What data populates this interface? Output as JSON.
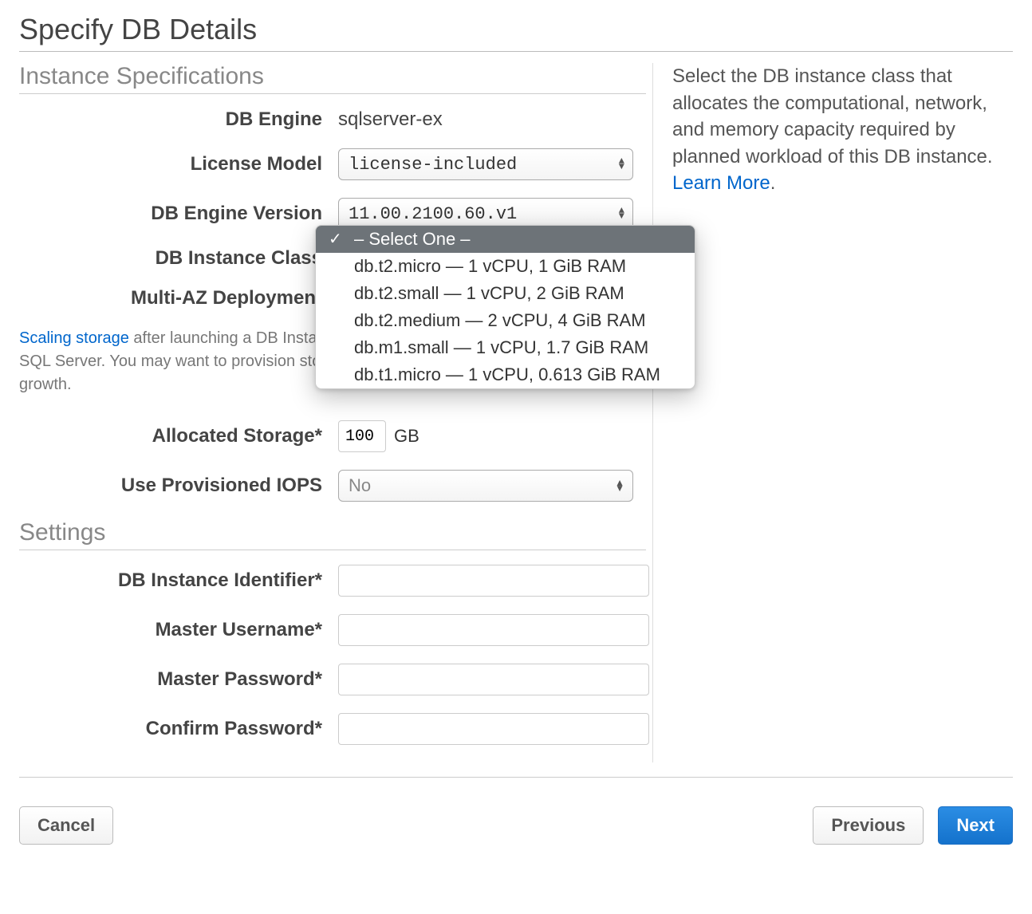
{
  "page": {
    "title": "Specify DB Details"
  },
  "sections": {
    "instance": "Instance Specifications",
    "settings": "Settings"
  },
  "labels": {
    "db_engine": "DB Engine",
    "license_model": "License Model",
    "engine_version": "DB Engine Version",
    "instance_class": "DB Instance Class",
    "multi_az": "Multi-AZ Deployment",
    "allocated_storage": "Allocated Storage*",
    "provisioned_iops": "Use Provisioned IOPS",
    "db_identifier": "DB Instance Identifier*",
    "master_username": "Master Username*",
    "master_password": "Master Password*",
    "confirm_password": "Confirm Password*"
  },
  "values": {
    "db_engine": "sqlserver-ex",
    "license_model": "license-included",
    "engine_version": "11.00.2100.60.v1",
    "allocated_storage": "100",
    "storage_unit": "GB",
    "provisioned_iops": "No",
    "db_identifier": "",
    "master_username": "",
    "master_password": "",
    "confirm_password": ""
  },
  "instance_class_dropdown": {
    "selected_index": 0,
    "options": [
      "– Select One –",
      "db.t2.micro — 1 vCPU, 1 GiB RAM",
      "db.t2.small — 1 vCPU, 2 GiB RAM",
      "db.t2.medium — 2 vCPU, 4 GiB RAM",
      "db.m1.small — 1 vCPU, 1.7 GiB RAM",
      "db.t1.micro — 1 vCPU, 0.613 GiB RAM"
    ]
  },
  "note": {
    "link_text": "Scaling storage",
    "rest": " after launching a DB Instance is currently not supported for Microsoft SQL Server. You may want to provision storage based on anticipated future storage growth."
  },
  "help": {
    "text_before": "Select the DB instance class that allocates the computational, network, and memory capacity required by planned workload of this DB instance. ",
    "link_text": "Learn More",
    "period": "."
  },
  "buttons": {
    "cancel": "Cancel",
    "previous": "Previous",
    "next": "Next"
  }
}
